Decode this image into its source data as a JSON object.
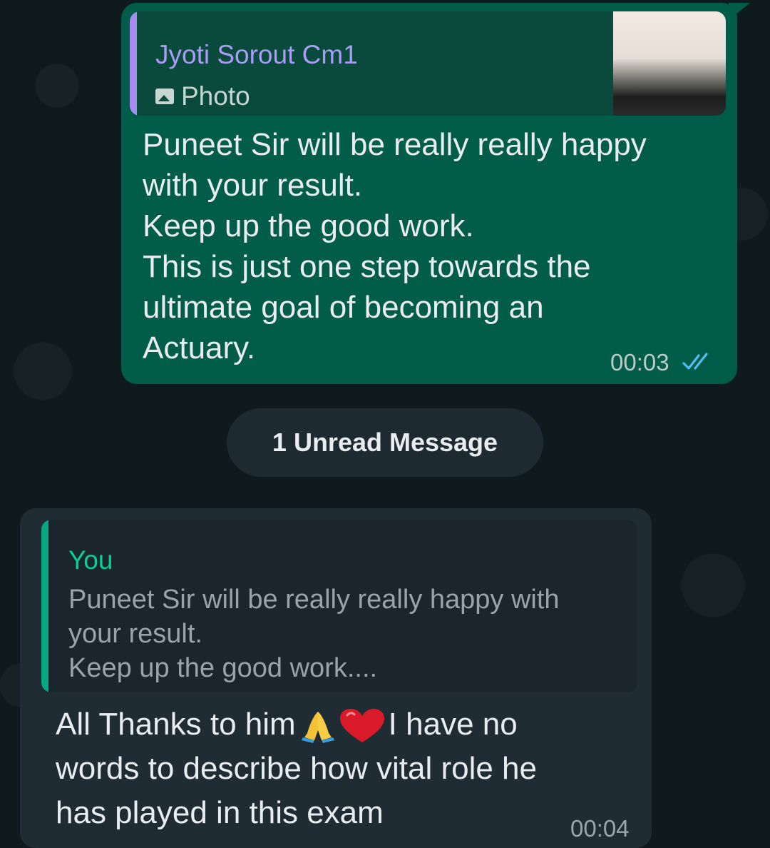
{
  "colors": {
    "outgoing_bubble": "#025c4a",
    "incoming_bubble": "#1f2c33",
    "quote_bar_outgoing": "#a48cf0",
    "quote_bar_incoming": "#06a884",
    "read_ticks": "#53bdeb"
  },
  "outgoing_message": {
    "quote": {
      "author": "Jyoti Sorout Cm1",
      "media_icon": "photo-icon",
      "media_label": "Photo"
    },
    "lines": [
      "Puneet Sir will be really really happy",
      "with your result.",
      "Keep up the good work.",
      "This is just one step towards the",
      "ultimate goal of becoming an",
      "Actuary."
    ],
    "time": "00:03",
    "status_icon": "double-check-icon"
  },
  "unread_divider": {
    "label": "1 Unread Message"
  },
  "incoming_message": {
    "quote": {
      "author": "You",
      "lines": [
        "Puneet Sir will be really really happy with",
        "your result.",
        "Keep up the good work...."
      ]
    },
    "line1_before": "All Thanks to him",
    "line1_after": "I have no",
    "lines": [
      "words to describe how vital role he",
      "has played in this exam"
    ],
    "emojis": [
      "folded-hands-icon",
      "red-heart-icon"
    ],
    "time": "00:04"
  }
}
